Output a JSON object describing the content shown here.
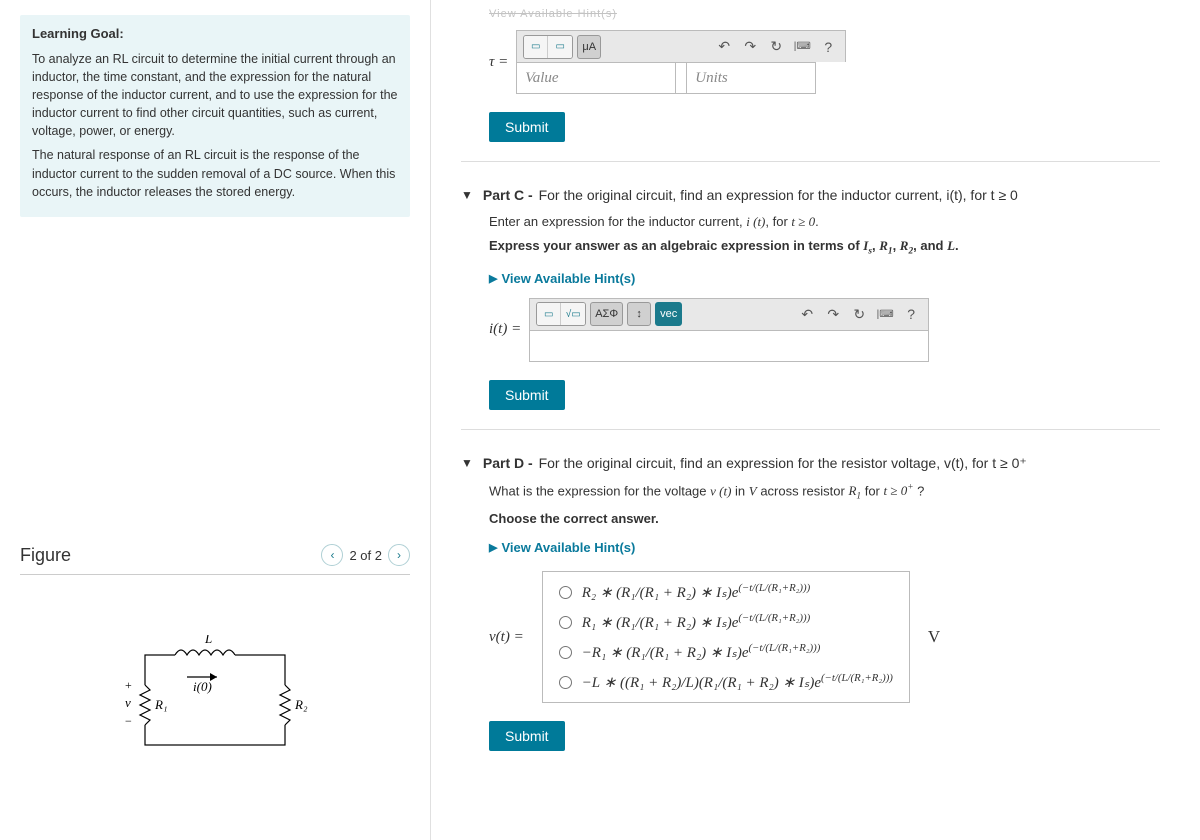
{
  "goal": {
    "title": "Learning Goal:",
    "p1": "To analyze an RL circuit to determine the initial current through an inductor, the time constant, and the expression for the natural response of the inductor current, and to use the expression for the inductor current to find other circuit quantities, such as current, voltage, power, or energy.",
    "p2": "The natural response of an RL circuit is the response of the inductor current to the sudden removal of a DC source. When this occurs, the inductor releases the stored energy."
  },
  "figure": {
    "title": "Figure",
    "pager": "2 of 2",
    "labels": {
      "L": "L",
      "i0": "i(0)",
      "v": "v",
      "R1": "R₁",
      "R2": "R₂"
    }
  },
  "truncated_top": "View Available Hint(s)",
  "partB": {
    "tau_label": "τ =",
    "value_placeholder": "Value",
    "units_placeholder": "Units",
    "submit": "Submit"
  },
  "partC": {
    "header_bold": "Part C -",
    "header_rest": " For the original circuit, find an expression for the inductor current, i(t), for t ≥ 0",
    "instr1_a": "Enter an expression for the inductor current, ",
    "instr1_b": ", for ",
    "instr1_c": ".",
    "instr2_a": "Express your answer as an algebraic expression in terms of ",
    "instr2_b": ", and ",
    "instr2_c": ".",
    "hints": "View Available Hint(s)",
    "eq_label": "i(t) =",
    "submit": "Submit"
  },
  "partD": {
    "header_bold": "Part D -",
    "header_rest": " For the original circuit, find an expression for the resistor voltage, v(t), for t ≥ 0⁺",
    "q_a": "What is the expression for the voltage ",
    "q_b": " in ",
    "q_c": "  across resistor  ",
    "q_d": " for ",
    "q_e": " ?",
    "choose": "Choose the correct answer.",
    "hints": "View Available Hint(s)",
    "eq_label": "v(t) =",
    "unit": "V",
    "submit": "Submit",
    "options": {
      "o1_a": "R₂ ∗ (R₁/(R₁ + R₂) ∗ Iₛ)e",
      "o1_exp": "(−t/(L/(R₁+R₂)))",
      "o2_a": "R₁ ∗ (R₁/(R₁ + R₂) ∗ Iₛ)e",
      "o2_exp": "(−t/(L/(R₁+R₂)))",
      "o3_a": "−R₁ ∗ (R₁/(R₁ + R₂) ∗ Iₛ)e",
      "o3_exp": "(−t/(L/(R₁+R₂)))",
      "o4_a": "−L ∗ ((R₁ + R₂)/L)(R₁/(R₁ + R₂) ∗ Iₛ)e",
      "o4_exp": "(−t/(L/(R₁+R₂)))"
    }
  },
  "toolbar": {
    "mu": "μA",
    "undo": "↶",
    "redo": "↷",
    "reset": "↻",
    "kbd": "⌨",
    "help": "?",
    "sqrt": "√",
    "sigma": "ΑΣΦ",
    "frac": "x/y",
    "vec": "vec"
  }
}
